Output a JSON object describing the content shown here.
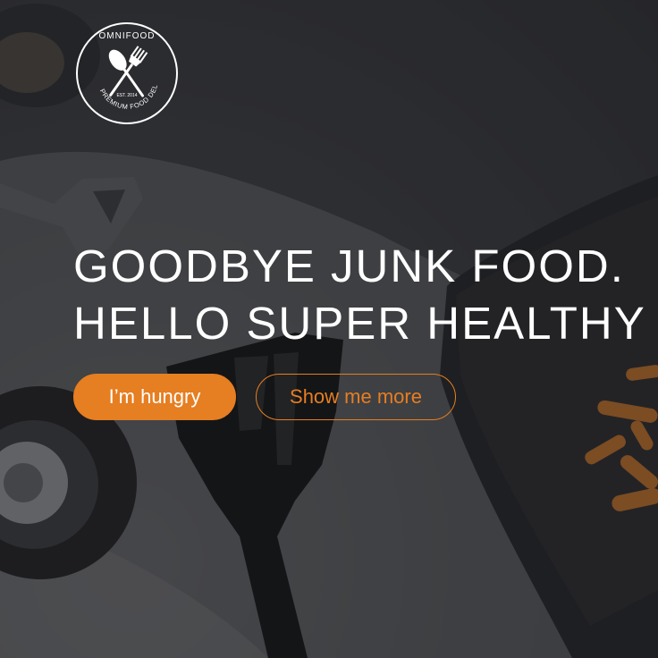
{
  "brand": {
    "name": "OMNIFOOD",
    "tagline": "PREMIUM FOOD DELIVERY",
    "established": "EST. 2014"
  },
  "hero": {
    "headline_line1": "GOODBYE JUNK FOOD.",
    "headline_line2": "HELLO SUPER HEALTHY MEALS.",
    "primary_button": "I’m hungry",
    "secondary_button": "Show me more"
  },
  "colors": {
    "accent": "#e67e22",
    "text": "#ffffff"
  }
}
